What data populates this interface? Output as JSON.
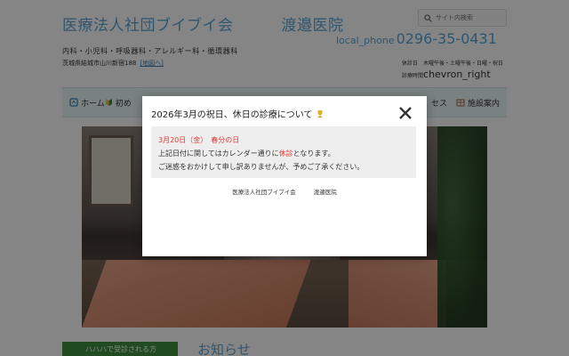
{
  "header": {
    "corp_name": "医療法人社団ブイブイ会",
    "clinic_name": "渡邉医院",
    "subjects": "内科・小児科・呼吸器科・アレルギー科・循環器科",
    "address": "茨城県結城市山川新宿188",
    "map_link": "[地図へ]",
    "search_placeholder": "サイト内検索",
    "phone_icon": "local_phone",
    "phone": "0296-35-0431",
    "hours_text": "休診日　木曜午後・土曜午後・日曜・祝日　診療時間",
    "hours_chevron": "chevron_right"
  },
  "nav": {
    "items": [
      {
        "label": "ホーム",
        "icon": "home-icon"
      },
      {
        "label": "初め",
        "icon": "beginner-icon"
      },
      {
        "label": "セス",
        "icon": "access-icon"
      },
      {
        "label": "施設案内",
        "icon": "facility-icon"
      }
    ]
  },
  "modal": {
    "title": "2026年3月の祝日、休日の診療について",
    "title_icon": "trophy-icon",
    "notice_date": "3月20日（金）　春分の日",
    "notice_line1_pre": "上記日付に関してはカレンダー通りに",
    "notice_line1_holiday": "休診",
    "notice_line1_post": "となります。",
    "notice_line2": "ご迷惑をおかけして申し訳ありませんが、予めご了承ください。",
    "signature_corp": "医療法人社団ブイブイ会",
    "signature_clinic": "渡邉医院"
  },
  "footer": {
    "banner_text": "ハハハで受診される方",
    "news_heading": "お知らせ"
  },
  "colors": {
    "accent": "#5aa6d6",
    "alert": "#e53935",
    "nav_bg": "#e9f7f7",
    "banner": "#3e9140"
  }
}
